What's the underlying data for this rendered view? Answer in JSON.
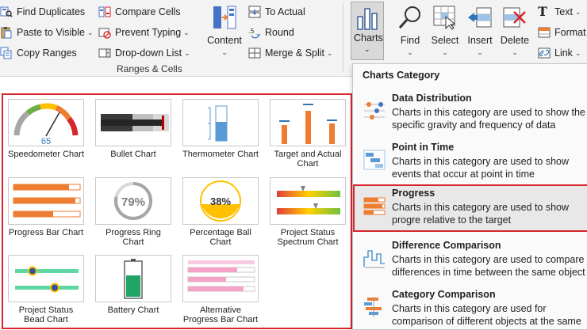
{
  "ribbon": {
    "find_duplicates": "Find Duplicates",
    "paste_to_visible": "Paste to Visible",
    "copy_ranges": "Copy Ranges",
    "compare_cells": "Compare Cells",
    "prevent_typing": "Prevent Typing",
    "dropdown_list": "Drop-down List",
    "content": "Content",
    "to_actual": "To Actual",
    "round": "Round",
    "merge_split": "Merge & Split",
    "group_ranges_cells": "Ranges & Cells",
    "charts": "Charts",
    "find": "Find",
    "select": "Select",
    "insert": "Insert",
    "delete": "Delete",
    "text": "Text",
    "format": "Format",
    "link": "Link"
  },
  "gallery": {
    "items": [
      {
        "label": "Speedometer Chart",
        "value": "65"
      },
      {
        "label": "Bullet Chart"
      },
      {
        "label": "Thermometer Chart"
      },
      {
        "label": "Target and Actual Chart"
      },
      {
        "label": "Progress Bar Chart"
      },
      {
        "label": "Progress Ring Chart",
        "value": "79%"
      },
      {
        "label": "Percentage Ball Chart",
        "value": "38%"
      },
      {
        "label": "Project Status Spectrum Chart"
      },
      {
        "label": "Project Status Bead Chart"
      },
      {
        "label": "Battery Chart"
      },
      {
        "label": "Alternative Progress Bar Chart"
      }
    ]
  },
  "menu": {
    "title": "Charts Category",
    "items": [
      {
        "title": "Data Distribution",
        "desc": "Charts in this category are used to show the specific gravity and frequency of data distributi"
      },
      {
        "title": "Point in Time",
        "desc": "Charts in this category are used to show events that occur at point in time"
      },
      {
        "title": "Progress",
        "desc": "Charts in this category are used to show progre relative to the target"
      },
      {
        "title": "Difference Comparison",
        "desc": "Charts in this category are used to compare differences in time between the same object"
      },
      {
        "title": "Category Comparison",
        "desc": "Charts in this category are used for comparison of different objects at the same time"
      }
    ]
  },
  "colors": {
    "accent_red": "#d7262d",
    "orange": "#ed7d31",
    "blue": "#4472c4",
    "green": "#21a366"
  }
}
